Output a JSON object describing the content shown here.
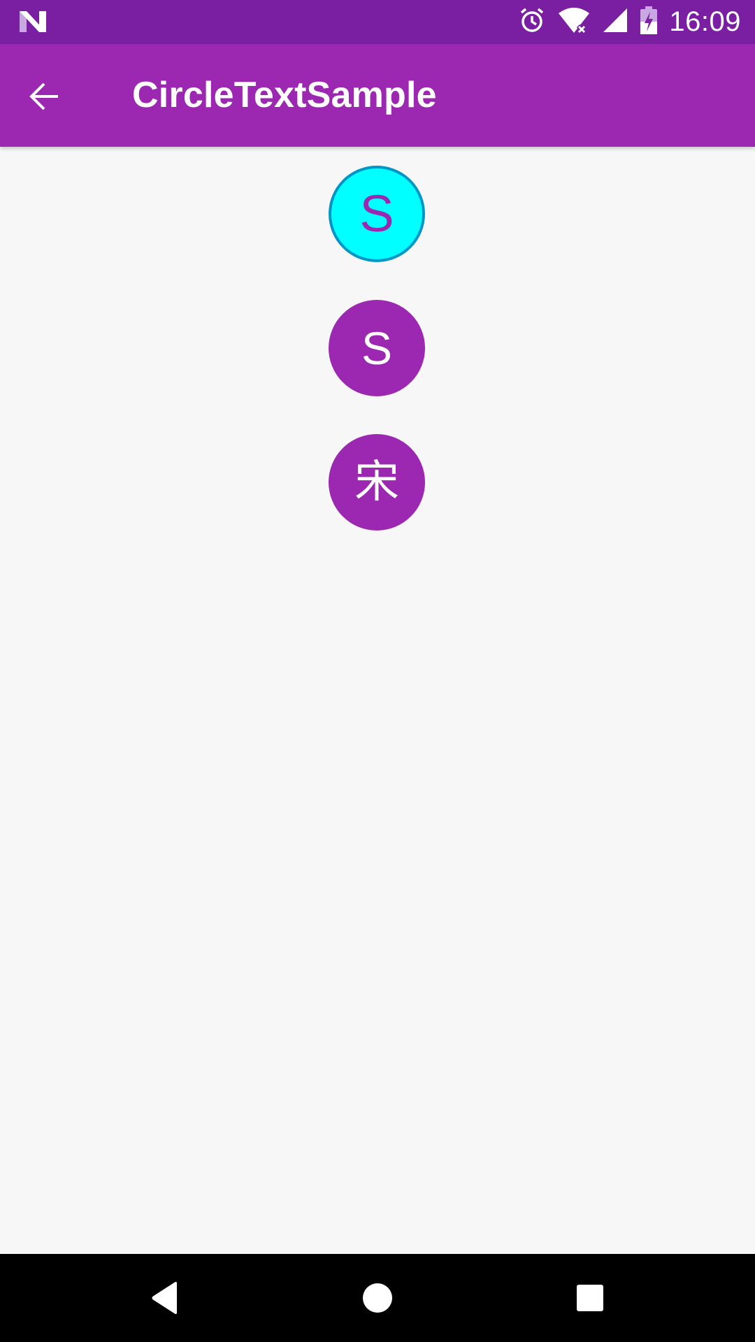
{
  "status_bar": {
    "time": "16:09",
    "icons": [
      "notification-n-icon",
      "alarm-clock-icon",
      "wifi-no-internet-icon",
      "cell-signal-icon",
      "battery-charging-icon"
    ]
  },
  "app_bar": {
    "title": "CircleTextSample",
    "back_icon": "arrow-back-icon"
  },
  "circles": [
    {
      "text": "S",
      "fill": "#00ffff",
      "border": "#0097c7",
      "text_color": "#9c27b0"
    },
    {
      "text": "S",
      "fill": "#9c27b0",
      "text_color": "#ffffff"
    },
    {
      "text": "宋",
      "fill": "#9c27b0",
      "text_color": "#ffffff"
    }
  ],
  "nav_bar": {
    "icons": [
      "nav-back-icon",
      "nav-home-icon",
      "nav-recents-icon"
    ]
  },
  "colors": {
    "status_bar": "#7b1fa2",
    "app_bar": "#9c27b0",
    "background": "#f7f7f7",
    "nav_bar": "#000000"
  }
}
